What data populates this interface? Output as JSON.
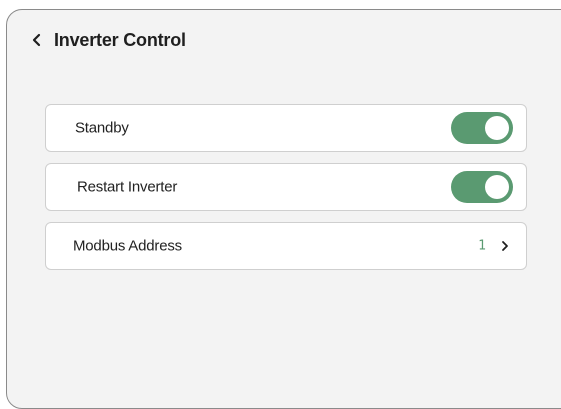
{
  "header": {
    "title": "Inverter Control",
    "back_icon": "chevron-left-icon"
  },
  "settings": [
    {
      "label": "Standby",
      "type": "toggle",
      "enabled": true
    },
    {
      "label": "Restart Inverter",
      "type": "toggle",
      "enabled": true
    },
    {
      "label": "Modbus Address",
      "type": "link",
      "value": "1",
      "icon": "chevron-right-icon"
    }
  ],
  "colors": {
    "accent": "#5a9a71",
    "panel_background": "#f3f3f3",
    "row_background": "#ffffff"
  }
}
